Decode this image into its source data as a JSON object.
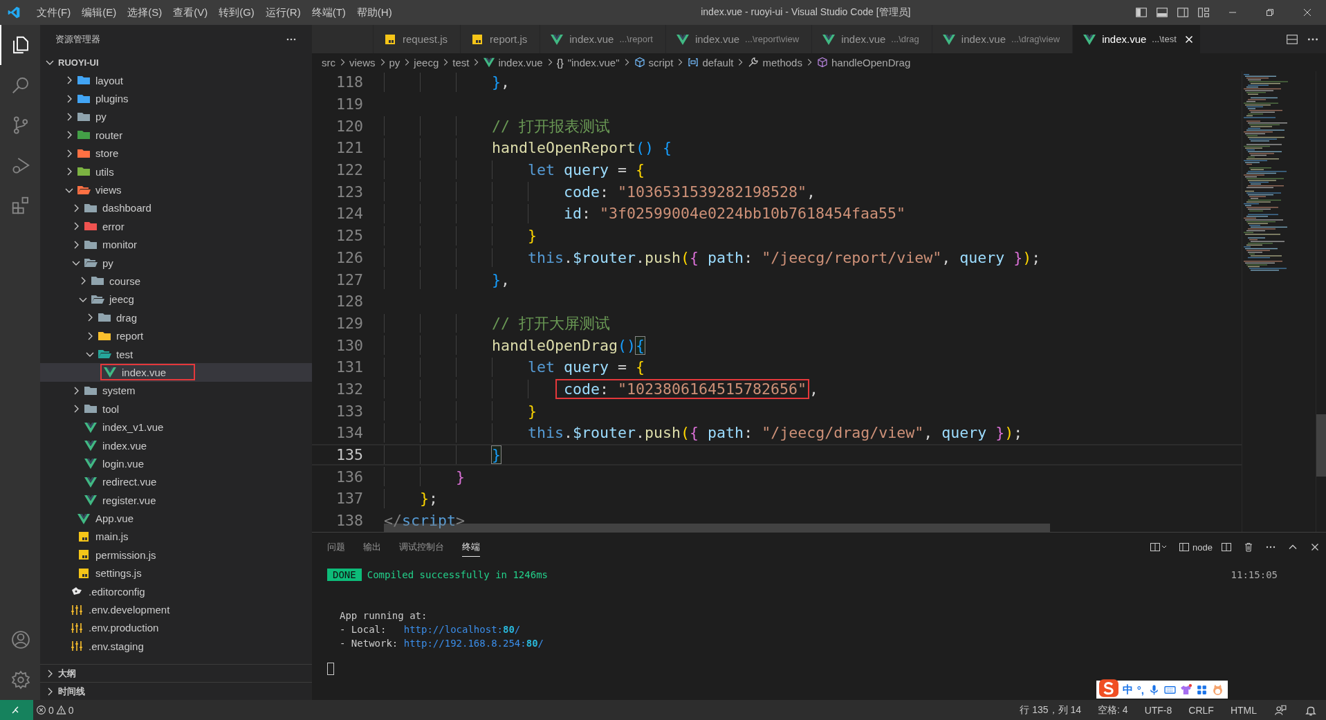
{
  "title_bar": {
    "menus": [
      "文件(F)",
      "编辑(E)",
      "选择(S)",
      "查看(V)",
      "转到(G)",
      "运行(R)",
      "终端(T)",
      "帮助(H)"
    ],
    "title": "index.vue - ruoyi-ui - Visual Studio Code [管理员]"
  },
  "activity_bar": {
    "items": [
      {
        "kind": "files",
        "selected": true
      },
      {
        "kind": "search",
        "selected": false
      },
      {
        "kind": "source-control",
        "selected": false
      },
      {
        "kind": "run",
        "selected": false
      },
      {
        "kind": "extensions",
        "selected": false
      }
    ],
    "bottom": [
      {
        "kind": "account"
      },
      {
        "kind": "settings"
      }
    ]
  },
  "explorer": {
    "title": "资源管理器",
    "root": {
      "label": "RUOYI-UI",
      "expanded": true
    },
    "tree": [
      {
        "kind": "scrolled",
        "children": [
          {
            "label": "layout",
            "kind": "folder",
            "color": "#42a5f5",
            "expanded": false,
            "selected": false
          },
          {
            "label": "plugins",
            "kind": "folder",
            "color": "#42a5f5",
            "expanded": false,
            "selected": false
          },
          {
            "label": "py",
            "kind": "folder",
            "color": "#90a4ae",
            "expanded": false,
            "selected": false
          },
          {
            "label": "router",
            "kind": "folder",
            "color": "#43a047",
            "expanded": false,
            "selected": false
          },
          {
            "label": "store",
            "kind": "folder",
            "color": "#ff7043",
            "expanded": false,
            "selected": false
          },
          {
            "label": "utils",
            "kind": "folder",
            "color": "#7cb342",
            "expanded": false,
            "selected": false
          },
          {
            "label": "views",
            "kind": "folder",
            "color": "#ff7043",
            "expanded": true,
            "selected": false,
            "children": [
              {
                "label": "dashboard",
                "kind": "folder",
                "color": "#90a4ae",
                "expanded": false,
                "selected": false
              },
              {
                "label": "error",
                "kind": "folder",
                "color": "#ef5350",
                "expanded": false,
                "selected": false
              },
              {
                "label": "monitor",
                "kind": "folder",
                "color": "#90a4ae",
                "expanded": false,
                "selected": false
              },
              {
                "label": "py",
                "kind": "folder",
                "color": "#90a4ae",
                "expanded": true,
                "selected": false,
                "children": [
                  {
                    "label": "course",
                    "kind": "folder",
                    "color": "#90a4ae",
                    "expanded": false,
                    "selected": false
                  },
                  {
                    "label": "jeecg",
                    "kind": "folder",
                    "color": "#90a4ae",
                    "expanded": true,
                    "selected": false,
                    "children": [
                      {
                        "label": "drag",
                        "kind": "folder",
                        "color": "#90a4ae",
                        "expanded": false,
                        "selected": false
                      },
                      {
                        "label": "report",
                        "kind": "folder",
                        "color": "#fbc02d",
                        "expanded": false,
                        "selected": false
                      },
                      {
                        "label": "test",
                        "kind": "folder",
                        "color": "#26a69a",
                        "expanded": true,
                        "selected": false,
                        "children": [
                          {
                            "label": "index.vue",
                            "kind": "vue",
                            "selected": true,
                            "boxed": true
                          }
                        ]
                      }
                    ]
                  }
                ]
              },
              {
                "label": "system",
                "kind": "folder",
                "color": "#90a4ae",
                "expanded": false,
                "selected": false
              },
              {
                "label": "tool",
                "kind": "folder",
                "color": "#90a4ae",
                "expanded": false,
                "selected": false
              },
              {
                "label": "index_v1.vue",
                "kind": "vue",
                "selected": false
              },
              {
                "label": "index.vue",
                "kind": "vue",
                "selected": false
              },
              {
                "label": "login.vue",
                "kind": "vue",
                "selected": false
              },
              {
                "label": "redirect.vue",
                "kind": "vue",
                "selected": false
              },
              {
                "label": "register.vue",
                "kind": "vue",
                "selected": false
              }
            ]
          },
          {
            "label": "App.vue",
            "kind": "vue",
            "selected": false
          },
          {
            "label": "main.js",
            "kind": "js",
            "selected": false
          },
          {
            "label": "permission.js",
            "kind": "js",
            "selected": false
          },
          {
            "label": "settings.js",
            "kind": "js",
            "selected": false
          }
        ]
      },
      {
        "label": ".editorconfig",
        "kind": "editorconfig",
        "selected": false
      },
      {
        "label": ".env.development",
        "kind": "env",
        "selected": false
      },
      {
        "label": ".env.production",
        "kind": "env",
        "selected": false
      },
      {
        "label": ".env.staging",
        "kind": "env",
        "selected": false
      }
    ],
    "sections": [
      {
        "label": "大纲",
        "expanded": false
      },
      {
        "label": "时间线",
        "expanded": false
      }
    ]
  },
  "tabs": [
    {
      "label": "request.js",
      "kind": "js",
      "selected": false
    },
    {
      "label": "report.js",
      "kind": "js",
      "selected": false
    },
    {
      "label": "index.vue",
      "detail": "...\\report",
      "kind": "vue",
      "selected": false
    },
    {
      "label": "index.vue",
      "detail": "...\\report\\view",
      "kind": "vue",
      "selected": false
    },
    {
      "label": "index.vue",
      "detail": "...\\drag",
      "kind": "vue",
      "selected": false
    },
    {
      "label": "index.vue",
      "detail": "...\\drag\\view",
      "kind": "vue",
      "selected": false
    },
    {
      "label": "index.vue",
      "detail": "...\\test",
      "kind": "vue",
      "selected": true
    }
  ],
  "breadcrumb": [
    {
      "label": "src",
      "kind": "folder"
    },
    {
      "label": "views",
      "kind": "folder"
    },
    {
      "label": "py",
      "kind": "folder"
    },
    {
      "label": "jeecg",
      "kind": "folder"
    },
    {
      "label": "test",
      "kind": "folder"
    },
    {
      "label": "index.vue",
      "kind": "vue"
    },
    {
      "label": "\"index.vue\"",
      "glyph": "{}",
      "kind": "object"
    },
    {
      "label": "script",
      "kind": "element"
    },
    {
      "label": "default",
      "kind": "variable"
    },
    {
      "label": "methods",
      "kind": "wrench"
    },
    {
      "label": "handleOpenDrag",
      "kind": "cube"
    }
  ],
  "editor": {
    "lines": [
      {
        "num": "118",
        "tokens": [
          {
            "t": "            }",
            "kind": "b3"
          },
          {
            "t": ",",
            "kind": "punct"
          }
        ]
      },
      {
        "num": "119"
      },
      {
        "num": "120",
        "tokens": [
          {
            "t": "            // 打开报表测试",
            "kind": "comment"
          }
        ]
      },
      {
        "num": "121",
        "tokens": [
          {
            "t": "            handleOpenReport",
            "kind": "func"
          },
          {
            "t": "()",
            "kind": "b3"
          },
          {
            "t": " {",
            "kind": "b3"
          }
        ]
      },
      {
        "num": "122",
        "tokens": [
          {
            "t": "                let",
            "kind": "keyword"
          },
          {
            "t": " query",
            "kind": "var"
          },
          {
            "t": " = ",
            "kind": "punct"
          },
          {
            "t": "{",
            "kind": "b1"
          }
        ]
      },
      {
        "num": "123",
        "tokens": [
          {
            "t": "                    code",
            "kind": "var"
          },
          {
            "t": ": ",
            "kind": "punct"
          },
          {
            "t": "\"1036531539282198528\"",
            "kind": "string"
          },
          {
            "t": ",",
            "kind": "punct"
          }
        ]
      },
      {
        "num": "124",
        "tokens": [
          {
            "t": "                    id",
            "kind": "var"
          },
          {
            "t": ": ",
            "kind": "punct"
          },
          {
            "t": "\"3f02599004e0224bb10b7618454faa55\"",
            "kind": "string"
          }
        ]
      },
      {
        "num": "125",
        "tokens": [
          {
            "t": "                }",
            "kind": "b1"
          }
        ]
      },
      {
        "num": "126",
        "tokens": [
          {
            "t": "                this",
            "kind": "keyword"
          },
          {
            "t": ".",
            "kind": "punct"
          },
          {
            "t": "$router",
            "kind": "var"
          },
          {
            "t": ".",
            "kind": "punct"
          },
          {
            "t": "push",
            "kind": "func"
          },
          {
            "t": "(",
            "kind": "b1"
          },
          {
            "t": "{",
            "kind": "b2"
          },
          {
            "t": " path",
            "kind": "var"
          },
          {
            "t": ": ",
            "kind": "punct"
          },
          {
            "t": "\"/jeecg/report/view\"",
            "kind": "string"
          },
          {
            "t": ", ",
            "kind": "punct"
          },
          {
            "t": "query",
            "kind": "var"
          },
          {
            "t": " }",
            "kind": "b2"
          },
          {
            "t": ")",
            "kind": "b1"
          },
          {
            "t": ";",
            "kind": "punct"
          }
        ]
      },
      {
        "num": "127",
        "tokens": [
          {
            "t": "            }",
            "kind": "b3"
          },
          {
            "t": ",",
            "kind": "punct"
          }
        ]
      },
      {
        "num": "128"
      },
      {
        "num": "129",
        "tokens": [
          {
            "t": "            // 打开大屏测试",
            "kind": "comment"
          }
        ]
      },
      {
        "num": "130",
        "tokens": [
          {
            "t": "            handleOpenDrag",
            "kind": "func"
          },
          {
            "t": "()",
            "kind": "b3"
          },
          {
            "t": "{",
            "kind": "b3",
            "matched": true
          }
        ]
      },
      {
        "num": "131",
        "tokens": [
          {
            "t": "                let",
            "kind": "keyword"
          },
          {
            "t": " query",
            "kind": "var"
          },
          {
            "t": " = ",
            "kind": "punct"
          },
          {
            "t": "{",
            "kind": "b1"
          }
        ]
      },
      {
        "num": "132",
        "boxed": [
          {
            "t": "                    code",
            "kind": "var"
          },
          {
            "t": ": ",
            "kind": "punct"
          },
          {
            "t": "\"1023806164515782656\"",
            "kind": "string"
          }
        ],
        "tokens": [
          {
            "t": ",",
            "kind": "punct"
          }
        ]
      },
      {
        "num": "133",
        "tokens": [
          {
            "t": "                }",
            "kind": "b1"
          }
        ]
      },
      {
        "num": "134",
        "tokens": [
          {
            "t": "                this",
            "kind": "keyword"
          },
          {
            "t": ".",
            "kind": "punct"
          },
          {
            "t": "$router",
            "kind": "var"
          },
          {
            "t": ".",
            "kind": "punct"
          },
          {
            "t": "push",
            "kind": "func"
          },
          {
            "t": "(",
            "kind": "b1"
          },
          {
            "t": "{",
            "kind": "b2"
          },
          {
            "t": " path",
            "kind": "var"
          },
          {
            "t": ": ",
            "kind": "punct"
          },
          {
            "t": "\"/jeecg/drag/view\"",
            "kind": "string"
          },
          {
            "t": ", ",
            "kind": "punct"
          },
          {
            "t": "query",
            "kind": "var"
          },
          {
            "t": " }",
            "kind": "b2"
          },
          {
            "t": ")",
            "kind": "b1"
          },
          {
            "t": ";",
            "kind": "punct"
          }
        ]
      },
      {
        "num": "135",
        "current": true,
        "tokens": [
          {
            "t": "            }",
            "kind": "b3",
            "matched": true
          }
        ]
      },
      {
        "num": "136",
        "tokens": [
          {
            "t": "        }",
            "kind": "b2"
          }
        ]
      },
      {
        "num": "137",
        "tokens": [
          {
            "t": "    }",
            "kind": "b1"
          },
          {
            "t": ";",
            "kind": "punct"
          }
        ]
      },
      {
        "num": "138",
        "tokens": [
          {
            "t": "</",
            "kind": "tag"
          },
          {
            "t": "script",
            "kind": "tagname"
          },
          {
            "t": ">",
            "kind": "tag"
          }
        ]
      }
    ]
  },
  "panel": {
    "tabs": [
      {
        "label": "问题",
        "selected": false
      },
      {
        "label": "输出",
        "selected": false
      },
      {
        "label": "调试控制台",
        "selected": false
      },
      {
        "label": "终端",
        "selected": true
      }
    ],
    "terminal_name": "node",
    "terminal": {
      "badge": "DONE",
      "message": "Compiled successfully in 1246ms",
      "time": "11:15:05",
      "heading": "App running at:",
      "links": [
        {
          "label": "- Local:",
          "url": "http://localhost:**80**/"
        },
        {
          "label": "- Network:",
          "url": "http://192.168.8.254:**80**/"
        }
      ]
    }
  },
  "ime_bar": {
    "mode": "中",
    "punct": "°,"
  },
  "status_bar": {
    "errors": "0",
    "warnings": "0",
    "items": [
      "行 135，列 14",
      "空格: 4",
      "UTF-8",
      "CRLF",
      "HTML"
    ]
  }
}
